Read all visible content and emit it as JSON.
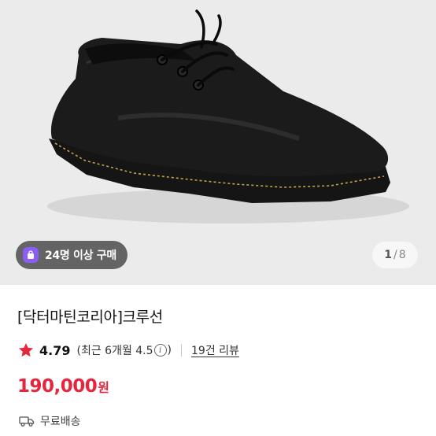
{
  "hero": {
    "image": "black leather derby shoe with yellow welt stitching",
    "buyers_badge": "24명 이상 구매",
    "pager": {
      "current": "1",
      "separator": "/",
      "total": "8"
    }
  },
  "product": {
    "title": "[닥터마틴코리아]크루선",
    "rating": "4.79",
    "rating_recent_prefix": "(최근 6개월 4.5",
    "rating_recent_suffix": ")",
    "review_count": "19건 리뷰",
    "price": "190,000",
    "currency": "원",
    "shipping": "무료배송"
  },
  "colors": {
    "accent": "#e5273e",
    "badge_bag": "#8b5cf6",
    "hero_bg": "#ebebeb"
  },
  "icons": [
    "shopping-bag-icon",
    "star-icon",
    "info-icon",
    "truck-icon"
  ]
}
